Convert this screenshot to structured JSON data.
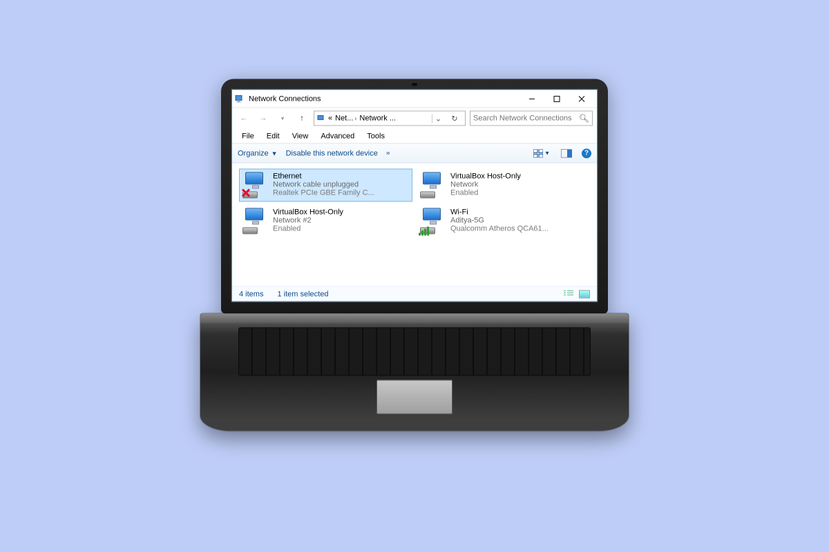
{
  "window": {
    "title": "Network Connections"
  },
  "address": {
    "lead": "«",
    "crumbs": [
      "Net...",
      "Network ..."
    ]
  },
  "search": {
    "placeholder": "Search Network Connections"
  },
  "menubar": [
    "File",
    "Edit",
    "View",
    "Advanced",
    "Tools"
  ],
  "toolbar": {
    "organize": "Organize",
    "disable": "Disable this network device",
    "more": "»"
  },
  "connections": [
    {
      "name": "Ethernet",
      "line2": "Network cable unplugged",
      "line3": "Realtek PCIe GBE Family C...",
      "selected": true,
      "unplugged": true,
      "signal": false
    },
    {
      "name": "VirtualBox Host-Only",
      "line2": "Network",
      "line3": "Enabled",
      "selected": false,
      "unplugged": false,
      "signal": false
    },
    {
      "name": "VirtualBox Host-Only",
      "line2": "Network #2",
      "line3": "Enabled",
      "selected": false,
      "unplugged": false,
      "signal": false
    },
    {
      "name": "Wi-Fi",
      "line2": "Aditya-5G",
      "line3": "Qualcomm Atheros QCA61...",
      "selected": false,
      "unplugged": false,
      "signal": true
    }
  ],
  "statusbar": {
    "count": "4 items",
    "selected": "1 item selected"
  }
}
